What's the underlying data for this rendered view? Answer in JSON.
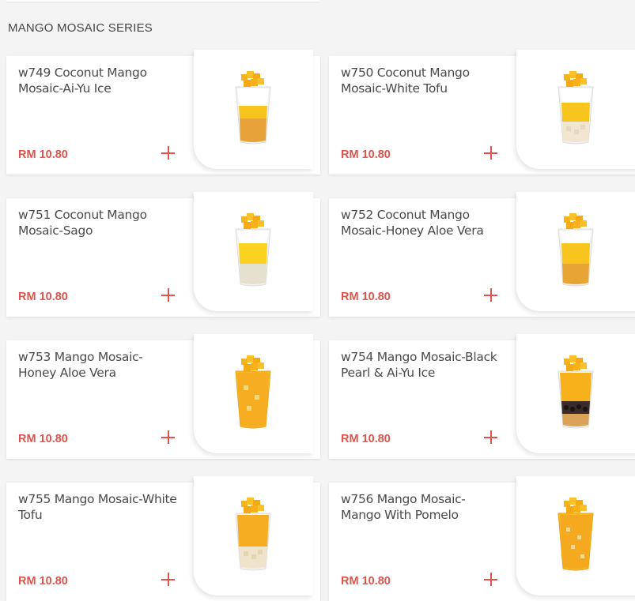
{
  "section": {
    "title": "MANGO MOSAIC SERIES"
  },
  "products": [
    {
      "name": "w749 Coconut Mango Mosaic-Ai-Yu Ice",
      "price": "RM 10.80",
      "image": "coconut-mango-ai-yu-ice"
    },
    {
      "name": "w750 Coconut Mango Mosaic-White Tofu",
      "price": "RM 10.80",
      "image": "coconut-mango-white-tofu"
    },
    {
      "name": "w751 Coconut Mango Mosaic-Sago",
      "price": "RM 10.80",
      "image": "coconut-mango-sago"
    },
    {
      "name": "w752 Coconut Mango Mosaic-Honey Aloe Vera",
      "price": "RM 10.80",
      "image": "coconut-mango-honey-aloe-vera"
    },
    {
      "name": "w753 Mango Mosaic-Honey Aloe Vera",
      "price": "RM 10.80",
      "image": "mango-honey-aloe-vera"
    },
    {
      "name": "w754 Mango Mosaic-Black Pearl & Ai-Yu Ice",
      "price": "RM 10.80",
      "image": "mango-black-pearl-ai-yu-ice"
    },
    {
      "name": "w755 Mango Mosaic-White Tofu",
      "price": "RM 10.80",
      "image": "mango-white-tofu"
    },
    {
      "name": "w756 Mango Mosaic-Mango With Pomelo",
      "price": "RM 10.80",
      "image": "mango-with-pomelo"
    }
  ],
  "colors": {
    "price": "#e0524a",
    "add": "#e0524a",
    "mango": "#f7b21b",
    "cream": "#ffffff"
  }
}
